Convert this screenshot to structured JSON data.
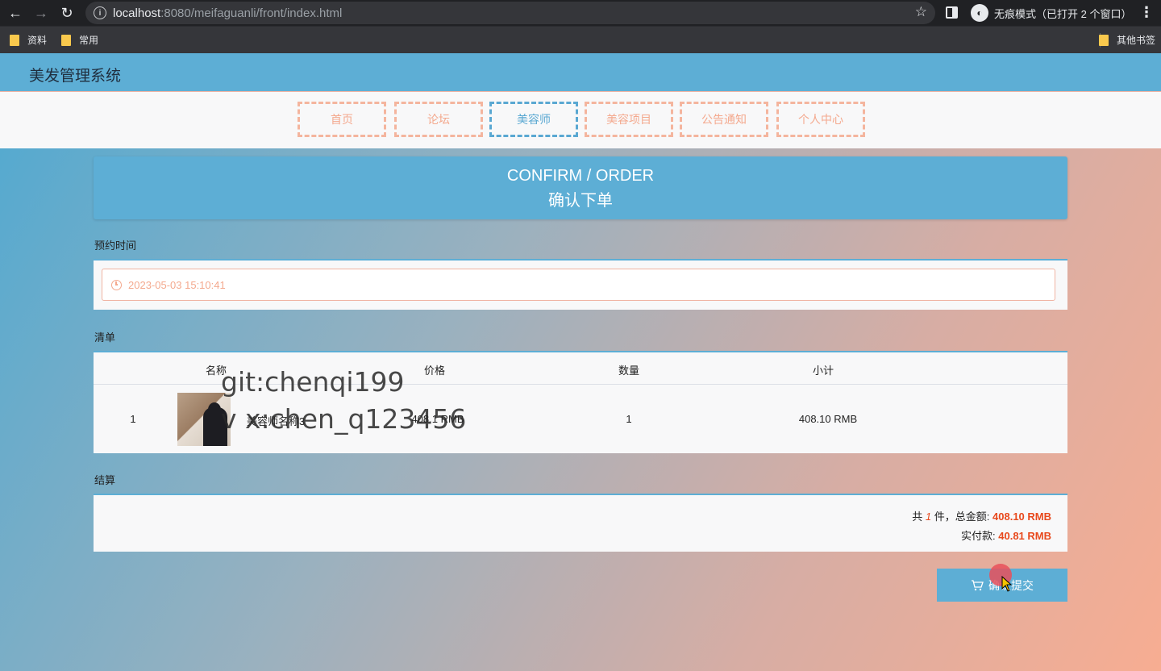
{
  "browser": {
    "url_host": "localhost",
    "url_rest": ":8080/meifaguanli/front/index.html",
    "incognito_label": "无痕模式（已打开 2 个窗口）",
    "bookmarks": [
      "资料",
      "常用"
    ],
    "other_bookmarks": "其他书签"
  },
  "app": {
    "title": "美发管理系统",
    "nav": [
      "首页",
      "论坛",
      "美容师",
      "美容项目",
      "公告通知",
      "个人中心"
    ],
    "active_nav": "美容师"
  },
  "banner": {
    "en": "CONFIRM / ORDER",
    "zh": "确认下单"
  },
  "booking": {
    "label": "预约时间",
    "value": "2023-05-03 15:10:41"
  },
  "list": {
    "label": "清单",
    "headers": [
      "名称",
      "价格",
      "数量",
      "小计"
    ],
    "rows": [
      {
        "index": "1",
        "name": "美容师名称3",
        "price": "408.1 RMB",
        "qty": "1",
        "subtotal": "408.10 RMB"
      }
    ]
  },
  "settlement": {
    "label": "结算",
    "count_prefix": "共",
    "count": "1",
    "count_suffix": "件，总金额:",
    "total": "408.10 RMB",
    "paid_label": "实付款:",
    "paid": "40.81 RMB"
  },
  "submit_label": "确认提交",
  "watermark": {
    "line1": "git:chenqi199",
    "line2": "v x:chen_q123456"
  },
  "colors": {
    "accent": "#5daed5",
    "nav_dashed": "#f4b59e",
    "price_highlight": "#e8491d"
  }
}
